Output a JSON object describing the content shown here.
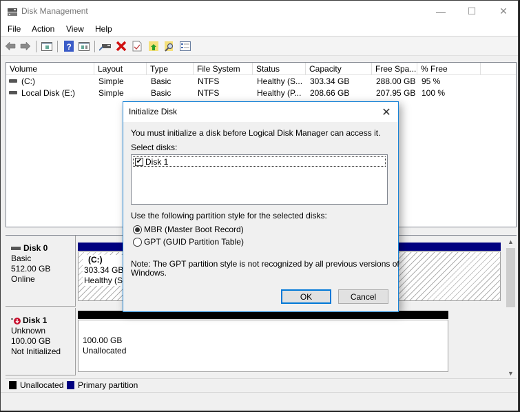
{
  "window": {
    "title": "Disk Management",
    "controls": {
      "minimize": "—",
      "maximize": "☐",
      "close": "✕"
    }
  },
  "menu": [
    "File",
    "Action",
    "View",
    "Help"
  ],
  "toolbar": {
    "icons": [
      "back-icon",
      "forward-icon",
      "show-hide-console-tree-icon",
      "help-icon",
      "show-hide-action-pane-icon",
      "connect-virtual-disk-icon",
      "delete-icon",
      "properties-icon",
      "open-icon",
      "explore-icon",
      "settings-icon"
    ]
  },
  "volume_list": {
    "columns": [
      "Volume",
      "Layout",
      "Type",
      "File System",
      "Status",
      "Capacity",
      "Free Spa...",
      "% Free"
    ],
    "rows": [
      {
        "volume": "(C:)",
        "layout": "Simple",
        "type": "Basic",
        "fs": "NTFS",
        "status": "Healthy (S...",
        "capacity": "303.34 GB",
        "free": "288.00 GB",
        "pct_free": "95 %"
      },
      {
        "volume": "Local Disk (E:)",
        "layout": "Simple",
        "type": "Basic",
        "fs": "NTFS",
        "status": "Healthy (P...",
        "capacity": "208.66 GB",
        "free": "207.95 GB",
        "pct_free": "100 %"
      }
    ]
  },
  "disks": [
    {
      "name": "Disk 0",
      "type": "Basic",
      "size": "512.00 GB",
      "state": "Online",
      "partition": {
        "label": "(C:)",
        "line1": "303.34 GB N",
        "line2": "Healthy (Sy"
      }
    },
    {
      "name": "Disk 1",
      "type": "Unknown",
      "size": "100.00 GB",
      "state": "Not Initialized",
      "partition": {
        "line1": "100.00 GB",
        "line2": "Unallocated"
      }
    }
  ],
  "legend": [
    {
      "label": "Unallocated",
      "color": "#000000"
    },
    {
      "label": "Primary partition",
      "color": "#000080"
    }
  ],
  "colors": {
    "primary_partition": "#000080",
    "unallocated": "#000000",
    "dialog_accent": "#0078d7"
  },
  "dialog": {
    "title": "Initialize Disk",
    "message": "You must initialize a disk before Logical Disk Manager can access it.",
    "select_label": "Select disks:",
    "disks": [
      {
        "label": "Disk 1",
        "checked": true
      }
    ],
    "style_label": "Use the following partition style for the selected disks:",
    "options": [
      {
        "label": "MBR (Master Boot Record)",
        "selected": true
      },
      {
        "label": "GPT (GUID Partition Table)",
        "selected": false
      }
    ],
    "note_line1": "Note: The GPT partition style is not recognized by all previous versions of",
    "note_line2": "Windows.",
    "ok": "OK",
    "cancel": "Cancel"
  }
}
